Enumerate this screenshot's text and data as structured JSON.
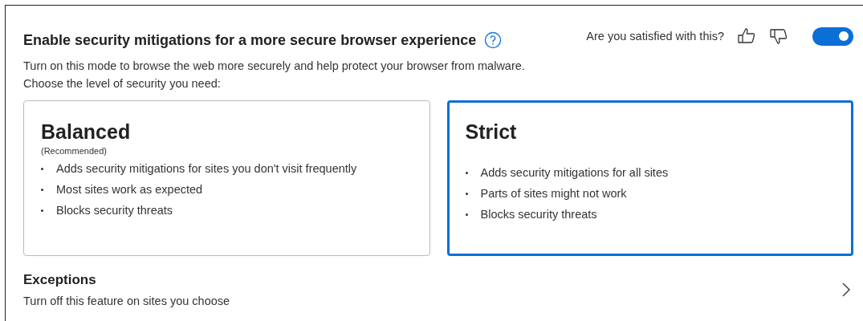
{
  "header": {
    "title": "Enable security mitigations for a more secure browser experience",
    "description": "Turn on this mode to browse the web more securely and help protect your browser from malware. Choose the level of security you need:"
  },
  "feedback": {
    "question": "Are you satisfied with this?"
  },
  "toggle": {
    "on": true
  },
  "options": [
    {
      "title": "Balanced",
      "subtitle": "(Recommended)",
      "selected": false,
      "bullets": [
        "Adds security mitigations for sites you don't visit frequently",
        "Most sites work as expected",
        "Blocks security threats"
      ]
    },
    {
      "title": "Strict",
      "selected": true,
      "bullets": [
        "Adds security mitigations for all sites",
        "Parts of sites might not work",
        "Blocks security threats"
      ]
    }
  ],
  "exceptions": {
    "title": "Exceptions",
    "description": "Turn off this feature on sites you choose"
  }
}
